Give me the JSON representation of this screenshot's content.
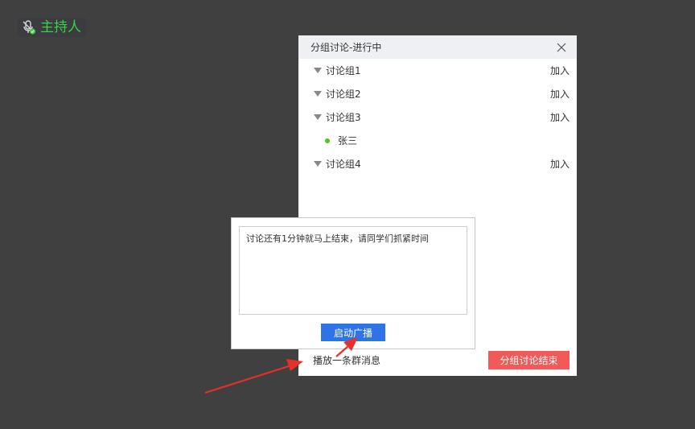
{
  "host": {
    "label": "主持人",
    "icon": "mic-icon",
    "color": "#3fd04a"
  },
  "panel": {
    "title": "分组讨论-进行中",
    "close_icon": "close-icon",
    "groups": [
      {
        "name": "讨论组1",
        "join": "加入"
      },
      {
        "name": "讨论组2",
        "join": "加入"
      },
      {
        "name": "讨论组3",
        "join": "加入",
        "members": [
          "张三"
        ]
      },
      {
        "name": "讨论组4",
        "join": "加入"
      }
    ],
    "footer": {
      "broadcast_label": "播放一条群消息",
      "end_label": "分组讨论结束",
      "end_color": "#f25a5a"
    }
  },
  "broadcast": {
    "message": "讨论还有1分钟就马上结束，请同学们抓紧时间",
    "start_label": "启动广播",
    "start_color": "#2f74e6"
  },
  "annotation": {
    "arrow_color": "#e8302a"
  }
}
